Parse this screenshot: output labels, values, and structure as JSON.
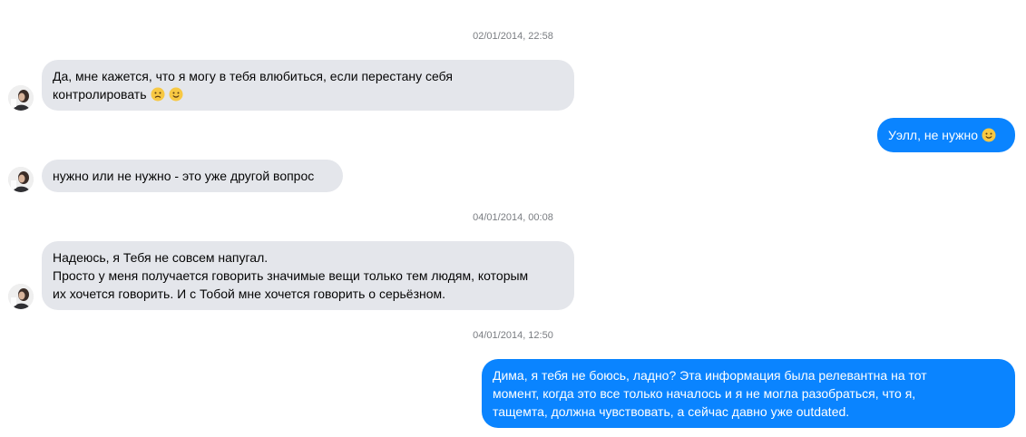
{
  "conversation": {
    "timestamps": [
      "02/01/2014, 22:58",
      "04/01/2014, 00:08",
      "04/01/2014, 12:50"
    ],
    "messages": [
      {
        "direction": "incoming",
        "text": "Да, мне кажется, что я могу в тебя влюбиться, если перестану себя\nконтролировать",
        "emojis": [
          "frowning-face",
          "smiling-face"
        ]
      },
      {
        "direction": "outgoing",
        "text": "Уэлл, не нужно",
        "emojis": [
          "smiling-face"
        ]
      },
      {
        "direction": "incoming",
        "text": "нужно или не нужно - это уже другой вопрос"
      },
      {
        "direction": "incoming",
        "text": "Надеюсь, я Тебя не совсем напугал.\nПросто у меня получается говорить значимые вещи только тем людям, которым\nих хочется говорить. И с Тобой мне хочется говорить о серьёзном."
      },
      {
        "direction": "outgoing",
        "text": "Дима, я тебя не боюсь, ладно? Эта информация была релевантна на тот\nмомент, когда это все только началось и я не могла разобраться, что я,\nтащемта, должна чувствовать, а сейчас давно уже outdated."
      }
    ]
  },
  "colors": {
    "incoming_bubble": "#e4e6eb",
    "outgoing_bubble": "#0a84ff",
    "timestamp_text": "#7a7d82"
  }
}
